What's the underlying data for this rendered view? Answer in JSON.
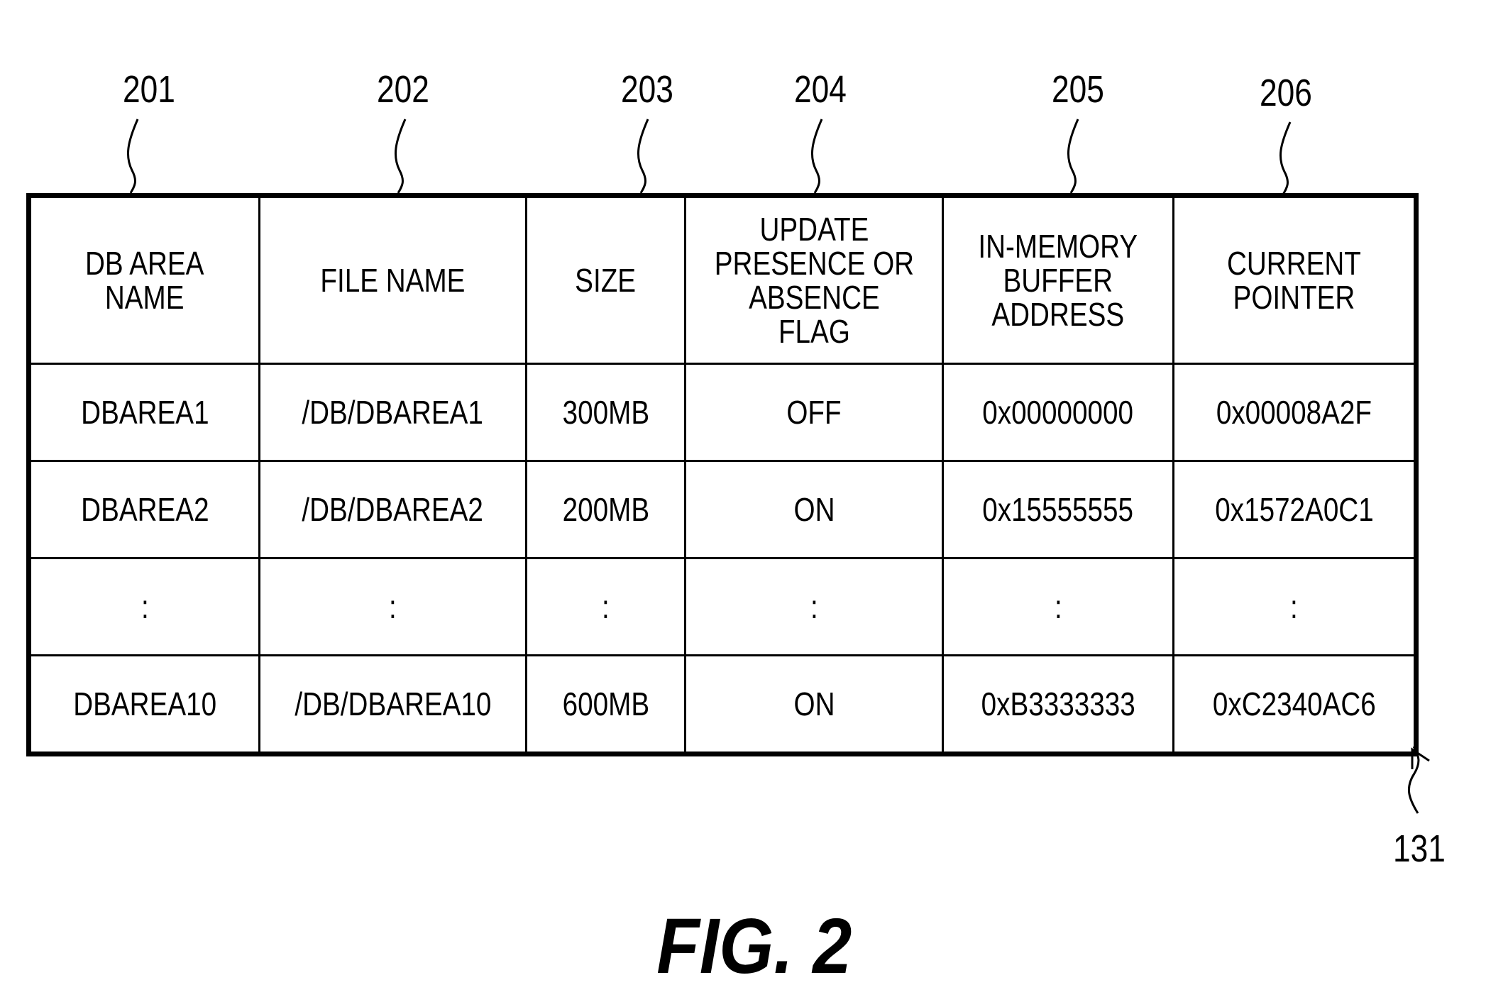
{
  "figure": {
    "caption": "FIG. 2",
    "table_ref": "131"
  },
  "column_refs": [
    "201",
    "202",
    "203",
    "204",
    "205",
    "206"
  ],
  "table": {
    "headers": [
      "DB AREA\nNAME",
      "FILE NAME",
      "SIZE",
      "UPDATE\nPRESENCE OR\nABSENCE\nFLAG",
      "IN-MEMORY\nBUFFER\nADDRESS",
      "CURRENT\nPOINTER"
    ],
    "rows": [
      [
        "DBAREA1",
        "/DB/DBAREA1",
        "300MB",
        "OFF",
        "0x00000000",
        "0x00008A2F"
      ],
      [
        "DBAREA2",
        "/DB/DBAREA2",
        "200MB",
        "ON",
        "0x15555555",
        "0x1572A0C1"
      ],
      [
        ":",
        ":",
        ":",
        ":",
        ":",
        ":"
      ],
      [
        "DBAREA10",
        "/DB/DBAREA10",
        "600MB",
        "ON",
        "0xB3333333",
        "0xC2340AC6"
      ]
    ]
  }
}
